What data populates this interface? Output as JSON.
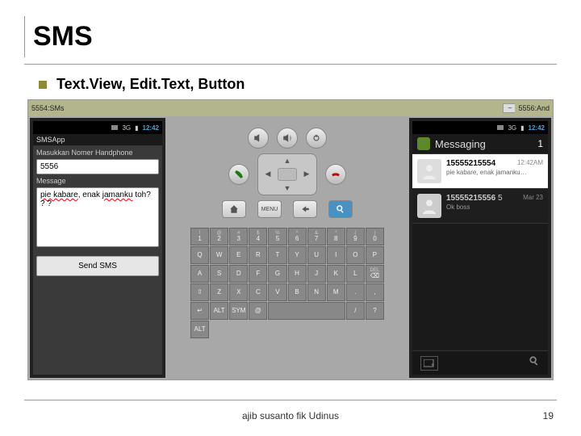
{
  "slide": {
    "title": "SMS",
    "bullet": "Text.View, Edit.Text, Button",
    "footer": "ajib susanto fik Udinus",
    "page": "19"
  },
  "windows": {
    "left_title": "5554:SMs",
    "right_title": "5556:And"
  },
  "time": "12:42",
  "app_left": {
    "title": "SMSApp",
    "label_phone": "Masukkan Nomer Handphone",
    "phone_value": "5556",
    "label_msg": "Message",
    "msg_spell1": "pie kabare",
    "msg_mid": ", enak ",
    "msg_spell2": "jamanku",
    "msg_tail": " toh? ? ?",
    "send": "Send SMS"
  },
  "emu": {
    "menu": "MENU"
  },
  "keyboard": {
    "row1": [
      {
        "sup": "!",
        "k": "1"
      },
      {
        "sup": "@",
        "k": "2"
      },
      {
        "sup": "#",
        "k": "3"
      },
      {
        "sup": "$",
        "k": "4"
      },
      {
        "sup": "%",
        "k": "5"
      },
      {
        "sup": "^",
        "k": "6"
      },
      {
        "sup": "&",
        "k": "7"
      },
      {
        "sup": "*",
        "k": "8"
      },
      {
        "sup": "(",
        "k": "9"
      },
      {
        "sup": ")",
        "k": "0"
      }
    ],
    "row2": [
      "Q",
      "W",
      "E",
      "R",
      "T",
      "Y",
      "U",
      "I",
      "O",
      "P"
    ],
    "row3": [
      "A",
      "S",
      "D",
      "F",
      "G",
      "H",
      "J",
      "K",
      "L"
    ],
    "row3_last": {
      "sup": "DEL",
      "k": "⌫"
    },
    "row4_first": "⇧",
    "row4": [
      "Z",
      "X",
      "C",
      "V",
      "B",
      "N",
      "M"
    ],
    "row4_punct": [
      ".",
      ","
    ],
    "row4_enter": "↵",
    "row5": [
      "ALT",
      "SYM",
      "@",
      " ",
      "/",
      "?",
      "ALT"
    ]
  },
  "app_right": {
    "header": "Messaging",
    "badge": "1",
    "threads": [
      {
        "number": "15555215554",
        "snippet": "pie kabare, enak jamanku…",
        "stamp": "12:42AM",
        "unread": true
      },
      {
        "number": "15555215556",
        "extra": "5",
        "snippet": "Ok boss",
        "stamp": "Mar 23",
        "unread": false
      }
    ]
  }
}
